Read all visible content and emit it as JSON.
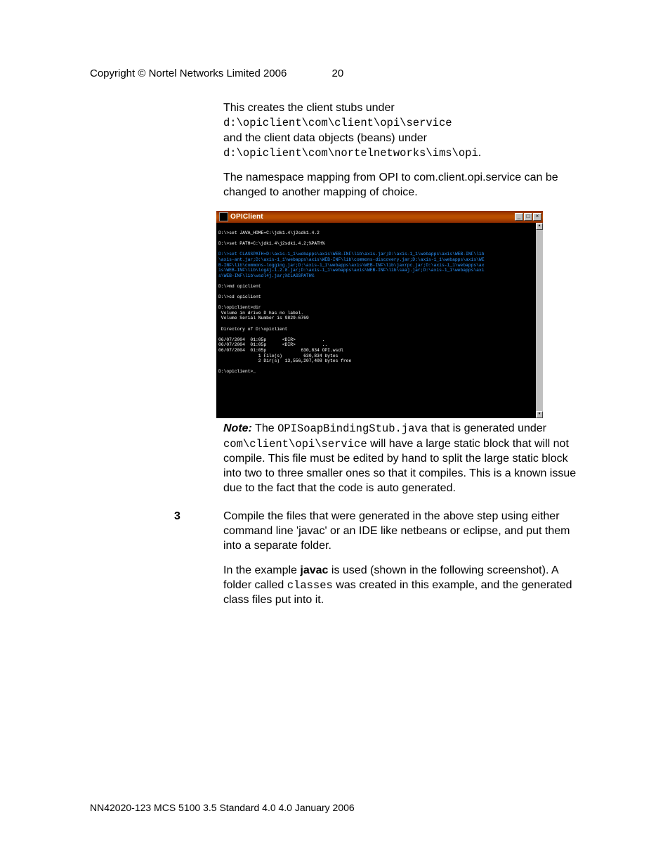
{
  "header": {
    "copyright": "Copyright © Nortel Networks Limited 2006",
    "page_number": "20"
  },
  "body": {
    "intro1": "This creates the client stubs under",
    "path1": "d:\\opiclient\\com\\client\\opi\\service",
    "intro2": "and the client data objects (beans) under",
    "path2": "d:\\opiclient\\com\\nortelnetworks\\ims\\opi",
    "intro2_end": ".",
    "para2": "The namespace mapping from OPI to com.client.opi.service can be changed to another mapping of choice.",
    "note": {
      "label": "Note:",
      "t1": "  The ",
      "code1": "OPISoapBindingStub.java",
      "t2": " that is generated under ",
      "code2": "com\\client\\opi\\service",
      "t3": " will have a large static block that will not compile. This file must be edited by hand to split the large static block into two to three smaller ones so that it compiles. This is a known issue due to the fact that the code is auto generated."
    },
    "step3": {
      "num": "3",
      "p1": "Compile the files that were generated in the above step using either command line 'javac' or an IDE like netbeans or eclipse, and put them into a separate folder.",
      "p2a": "In the example ",
      "p2b": "javac",
      "p2c": " is used (shown in the following screenshot).  A folder called ",
      "p2d": "classes",
      "p2e": " was created in this example, and the generated class files put into it."
    }
  },
  "terminal": {
    "title": "OPIClient",
    "btn_min": "_",
    "btn_max": "□",
    "btn_close": "×",
    "sb_up": "▴",
    "sb_down": "▾",
    "lines": [
      {
        "cls": "w",
        "t": ""
      },
      {
        "cls": "w",
        "t": "D:\\>set JAVA_HOME=C:\\jdk1.4\\j2sdk1.4.2"
      },
      {
        "cls": "w",
        "t": ""
      },
      {
        "cls": "w",
        "t": "D:\\>set PATH=C:\\jdk1.4\\j2sdk1.4.2;%PATH%"
      },
      {
        "cls": "w",
        "t": ""
      },
      {
        "cls": "c",
        "t": "D:\\>set CLASSPATH=D:\\axis-1_1\\webapps\\axis\\WEB-INF\\lib\\axis.jar;D:\\axis-1_1\\webapps\\axis\\WEB-INF\\lib"
      },
      {
        "cls": "c",
        "t": "\\axis-ant.jar;D:\\axis-1_1\\webapps\\axis\\WEB-INF\\lib\\commons-discovery.jar;D:\\axis-1_1\\webapps\\axis\\WE"
      },
      {
        "cls": "c",
        "t": "B-INF\\lib\\commons-logging.jar;D:\\axis-1_1\\webapps\\axis\\WEB-INF\\lib\\jaxrpc.jar;D:\\axis-1_1\\webapps\\ax"
      },
      {
        "cls": "c",
        "t": "is\\WEB-INF\\lib\\log4j-1.2.8.jar;D:\\axis-1_1\\webapps\\axis\\WEB-INF\\lib\\saaj.jar;D:\\axis-1_1\\webapps\\axi"
      },
      {
        "cls": "c",
        "t": "s\\WEB-INF\\lib\\wsdl4j.jar;%CLASSPATH%"
      },
      {
        "cls": "w",
        "t": ""
      },
      {
        "cls": "w",
        "t": "D:\\>md opiclient"
      },
      {
        "cls": "w",
        "t": ""
      },
      {
        "cls": "w",
        "t": "D:\\>cd opiclient"
      },
      {
        "cls": "w",
        "t": ""
      },
      {
        "cls": "w",
        "t": "D:\\opiclient>dir"
      },
      {
        "cls": "w",
        "t": " Volume in drive D has no label."
      },
      {
        "cls": "w",
        "t": " Volume Serial Number is 9829-6769"
      },
      {
        "cls": "w",
        "t": ""
      },
      {
        "cls": "w",
        "t": " Directory of D:\\opiclient"
      },
      {
        "cls": "w",
        "t": ""
      },
      {
        "cls": "w",
        "t": "06/07/2004  01:05p      <DIR>          ."
      },
      {
        "cls": "w",
        "t": "06/07/2004  01:05p      <DIR>          .."
      },
      {
        "cls": "w",
        "t": "06/07/2004  01:05p             630,834 OPI.wsdl"
      },
      {
        "cls": "w",
        "t": "               1 File(s)        630,834 bytes"
      },
      {
        "cls": "w",
        "t": "               2 Dir(s)  13,556,207,408 bytes free"
      },
      {
        "cls": "w",
        "t": ""
      },
      {
        "cls": "w",
        "t": "D:\\opiclient>_"
      }
    ]
  },
  "footer": {
    "text": "NN42020-123 MCS 5100 3.5   Standard 4.0   4.0   January 2006"
  }
}
